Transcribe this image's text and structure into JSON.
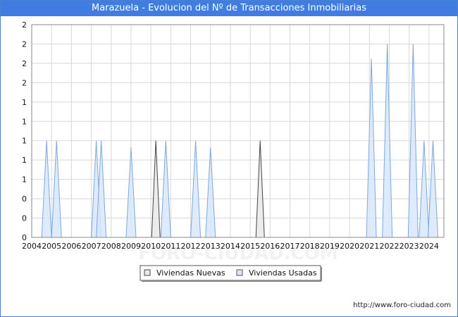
{
  "title": "Marazuela - Evolucion del Nº de Transacciones Inmobiliarias",
  "footer": "http://www.foro-ciudad.com",
  "watermark": "FORO-CIUDAD.COM",
  "colors": {
    "title_bg": "#3f7ee0",
    "nuevas_fill": "#e9e9e9",
    "nuevas_stroke": "#444444",
    "usadas_fill": "#d7e8fb",
    "usadas_stroke": "#7ea8dc"
  },
  "chart_data": {
    "type": "area",
    "title": "Marazuela - Evolucion del Nº de Transacciones Inmobiliarias",
    "x_tick_labels": [
      "2004",
      "2005",
      "2006",
      "2007",
      "2008",
      "2009",
      "2010",
      "2011",
      "2012",
      "2013",
      "2014",
      "2015",
      "2016",
      "2017",
      "2018",
      "2019",
      "2020",
      "2021",
      "2022",
      "2023",
      "2024"
    ],
    "y_tick_labels": [
      "0",
      "0",
      "0",
      "1",
      "1",
      "1",
      "1",
      "1",
      "2",
      "2",
      "2",
      "2"
    ],
    "ylim": [
      0,
      2.2
    ],
    "xlim": [
      2004,
      2024.75
    ],
    "grid": true,
    "legend_position": "bottom",
    "series": [
      {
        "name": "Viviendas Nuevas",
        "spikes": [
          {
            "x": 2010.25,
            "y": 1
          },
          {
            "x": 2015.5,
            "y": 1
          }
        ]
      },
      {
        "name": "Viviendas Usadas",
        "spikes": [
          {
            "x": 2004.75,
            "y": 1
          },
          {
            "x": 2005.25,
            "y": 1
          },
          {
            "x": 2007.25,
            "y": 1
          },
          {
            "x": 2007.5,
            "y": 1
          },
          {
            "x": 2009.0,
            "y": 0.93
          },
          {
            "x": 2010.75,
            "y": 1
          },
          {
            "x": 2012.25,
            "y": 1
          },
          {
            "x": 2013.0,
            "y": 0.93
          },
          {
            "x": 2021.1,
            "y": 1.85
          },
          {
            "x": 2021.9,
            "y": 2.0
          },
          {
            "x": 2023.2,
            "y": 2.0
          },
          {
            "x": 2023.75,
            "y": 1.0
          },
          {
            "x": 2024.2,
            "y": 1.0
          }
        ]
      }
    ]
  }
}
